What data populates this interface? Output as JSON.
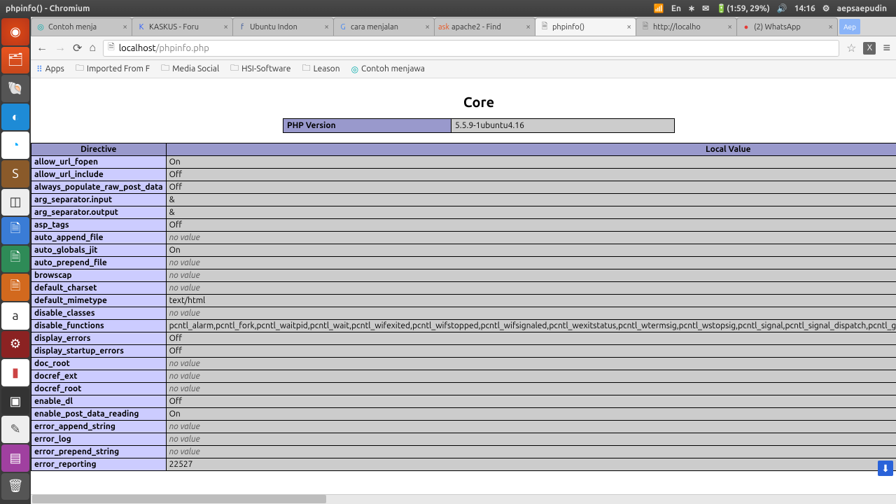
{
  "window_title": "phpinfo() - Chromium",
  "topbar": {
    "wifi": "wifi-icon",
    "lang": "En",
    "bt": "bluetooth-icon",
    "mail": "mail-icon",
    "battery": "(1:59, 29%)",
    "vol": "vol-icon",
    "time": "14:16",
    "gear": "gear-icon",
    "user": "aepsaepudin"
  },
  "tabs": [
    {
      "label": "Contoh menja",
      "fav": "◎",
      "color": "#0aa"
    },
    {
      "label": "KASKUS - Foru",
      "fav": "K",
      "color": "#2a5cff"
    },
    {
      "label": "Ubuntu Indon",
      "fav": "f",
      "color": "#3b5998"
    },
    {
      "label": "cara menjalan",
      "fav": "G",
      "color": "#4285f4"
    },
    {
      "label": "apache2 - Find",
      "fav": "ask",
      "color": "#e95420"
    },
    {
      "label": "phpinfo()",
      "fav": "🗎",
      "color": "#777",
      "active": true
    },
    {
      "label": "http://localho",
      "fav": "🗎",
      "color": "#777"
    },
    {
      "label": "(2) WhatsApp",
      "fav": "●",
      "color": "#e53935"
    }
  ],
  "profile_badge": "Aep",
  "nav": {
    "back": "←",
    "fwd": "→",
    "reload": "⟳",
    "home": "⌂"
  },
  "url_host": "localhost",
  "url_path": "/phpinfo.php",
  "bookmarks": [
    {
      "type": "apps",
      "label": "Apps"
    },
    {
      "type": "folder",
      "label": "Imported From F"
    },
    {
      "type": "folder",
      "label": "Media Social"
    },
    {
      "type": "folder",
      "label": "HSI-Software"
    },
    {
      "type": "folder",
      "label": "Leason"
    },
    {
      "type": "link",
      "label": "Contoh menjawa"
    }
  ],
  "page": {
    "section": "Core",
    "version_label": "PHP Version",
    "version_value": "5.5.9-1ubuntu4.16",
    "th_directive": "Directive",
    "th_local": "Local Value",
    "rows": [
      {
        "k": "allow_url_fopen",
        "v": "On"
      },
      {
        "k": "allow_url_include",
        "v": "Off"
      },
      {
        "k": "always_populate_raw_post_data",
        "v": "Off"
      },
      {
        "k": "arg_separator.input",
        "v": "&"
      },
      {
        "k": "arg_separator.output",
        "v": "&"
      },
      {
        "k": "asp_tags",
        "v": "Off"
      },
      {
        "k": "auto_append_file",
        "v": "no value",
        "novalue": true
      },
      {
        "k": "auto_globals_jit",
        "v": "On"
      },
      {
        "k": "auto_prepend_file",
        "v": "no value",
        "novalue": true
      },
      {
        "k": "browscap",
        "v": "no value",
        "novalue": true
      },
      {
        "k": "default_charset",
        "v": "no value",
        "novalue": true
      },
      {
        "k": "default_mimetype",
        "v": "text/html"
      },
      {
        "k": "disable_classes",
        "v": "no value",
        "novalue": true
      },
      {
        "k": "disable_functions",
        "v": "pcntl_alarm,pcntl_fork,pcntl_waitpid,pcntl_wait,pcntl_wifexited,pcntl_wifstopped,pcntl_wifsignaled,pcntl_wexitstatus,pcntl_wtermsig,pcntl_wstopsig,pcntl_signal,pcntl_signal_dispatch,pcntl_get_last_error,pcntl_"
      },
      {
        "k": "display_errors",
        "v": "Off"
      },
      {
        "k": "display_startup_errors",
        "v": "Off"
      },
      {
        "k": "doc_root",
        "v": "no value",
        "novalue": true
      },
      {
        "k": "docref_ext",
        "v": "no value",
        "novalue": true
      },
      {
        "k": "docref_root",
        "v": "no value",
        "novalue": true
      },
      {
        "k": "enable_dl",
        "v": "Off"
      },
      {
        "k": "enable_post_data_reading",
        "v": "On"
      },
      {
        "k": "error_append_string",
        "v": "no value",
        "novalue": true
      },
      {
        "k": "error_log",
        "v": "no value",
        "novalue": true
      },
      {
        "k": "error_prepend_string",
        "v": "no value",
        "novalue": true
      },
      {
        "k": "error_reporting",
        "v": "22527"
      }
    ]
  }
}
